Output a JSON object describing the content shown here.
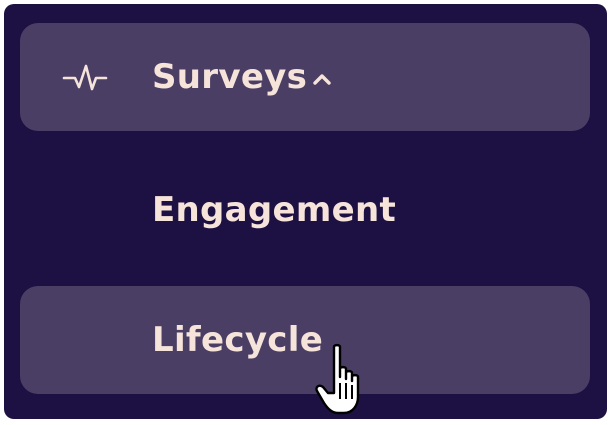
{
  "menu": {
    "surveys": {
      "label": "Surveys",
      "icon": "pulse-icon",
      "expand_icon": "chevron-up-icon",
      "expanded": true
    },
    "items": [
      {
        "label": "Engagement"
      },
      {
        "label": "Lifecycle",
        "hovered": true
      }
    ]
  },
  "colors": {
    "background": "#1d1042",
    "highlight": "#4a3e65",
    "text": "#f6e4da"
  },
  "cursor": {
    "icon": "hand-pointer-icon"
  }
}
